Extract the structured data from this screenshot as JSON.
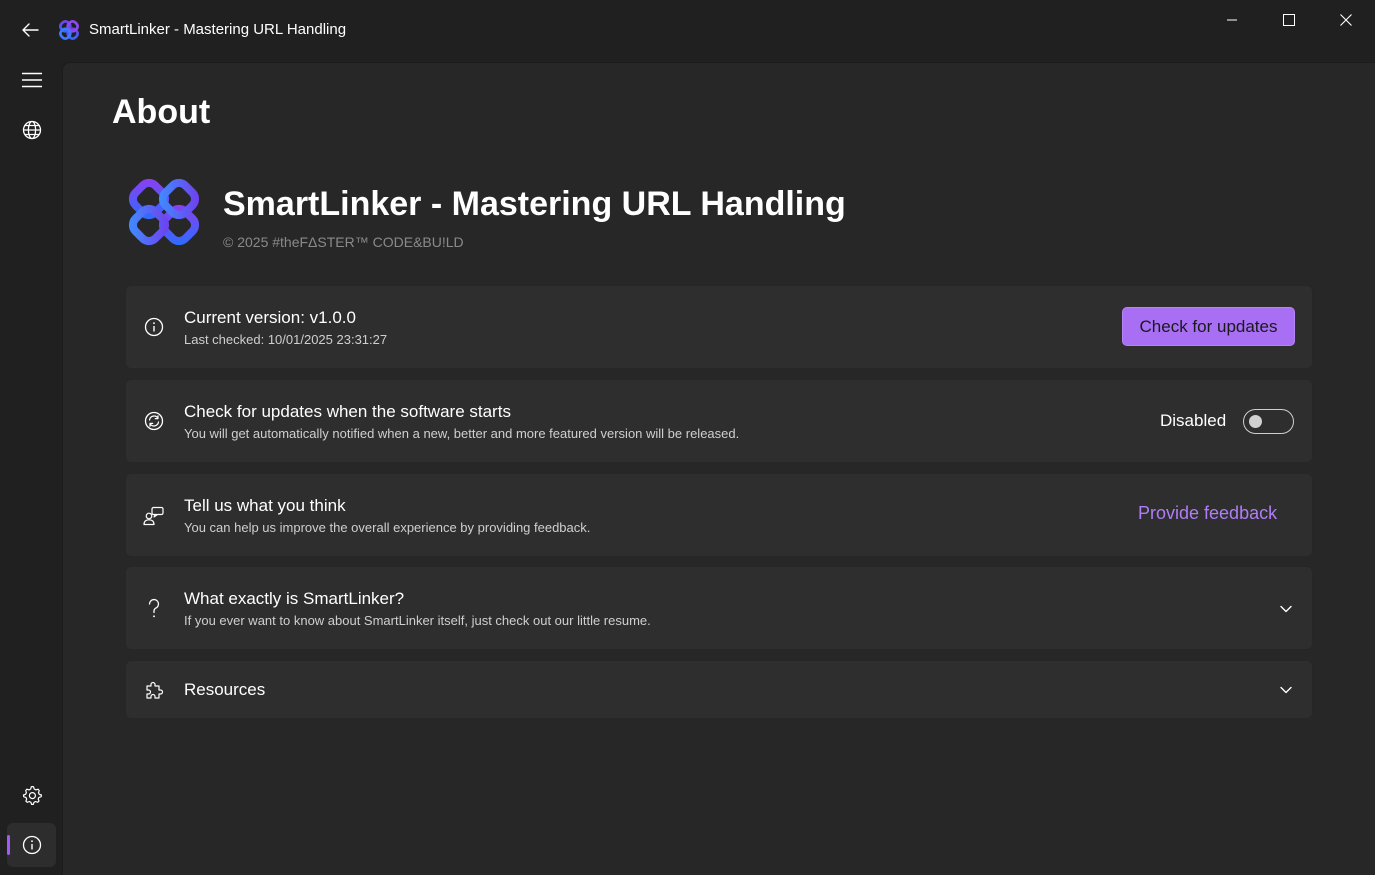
{
  "window": {
    "title": "SmartLinker - Mastering URL Handling",
    "controls": [
      "minimize",
      "maximize",
      "close"
    ]
  },
  "nav": {
    "items": [
      {
        "icon": "hamburger-icon",
        "label": "Menu"
      },
      {
        "icon": "globe-icon",
        "label": "Links"
      },
      {
        "icon": "gear-icon",
        "label": "Settings"
      },
      {
        "icon": "info-icon",
        "label": "About",
        "selected": true
      }
    ]
  },
  "page": {
    "title": "About"
  },
  "hero": {
    "app_name": "SmartLinker - Mastering URL Handling",
    "copyright": "© 2025 #theFΔSTER™ CODE&BU!LD"
  },
  "cards": {
    "version": {
      "title": "Current version: v1.0.0",
      "subtitle": "Last checked: 10/01/2025 23:31:27",
      "button": "Check for updates"
    },
    "startup": {
      "title": "Check for updates when the software starts",
      "subtitle": "You will get automatically notified when a new, better and more featured version will be released.",
      "toggle_label": "Disabled",
      "toggle_on": false
    },
    "feedback": {
      "title": "Tell us what you think",
      "subtitle": "You can help us improve the overall experience by providing feedback.",
      "link": "Provide feedback"
    },
    "what": {
      "title": "What exactly is SmartLinker?",
      "subtitle": "If you ever want to know about SmartLinker itself, just check out our little resume."
    },
    "resources": {
      "title": "Resources"
    }
  },
  "colors": {
    "accent": "#a86ef4",
    "link": "#b07df7",
    "background": "#202020",
    "content": "#272727",
    "card": "#2e2e2e"
  }
}
